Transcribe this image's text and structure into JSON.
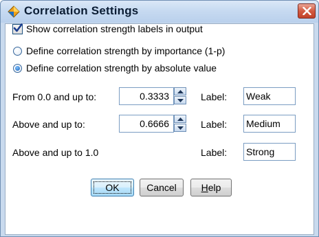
{
  "window": {
    "title": "Correlation Settings",
    "icon": "diamond-app-icon",
    "close_icon": "close-x-icon"
  },
  "options": {
    "show_labels": {
      "label": "Show correlation strength labels in output",
      "checked": true
    },
    "radios": [
      {
        "label": "Define correlation strength by importance (1-p)",
        "checked": false
      },
      {
        "label": "Define correlation strength by absolute value",
        "checked": true
      }
    ]
  },
  "thresholds": [
    {
      "label": "From 0.0 and up to:",
      "value": "0.3333",
      "label_caption": "Label:",
      "strength": "Weak"
    },
    {
      "label": "Above and up to:",
      "value": "0.6666",
      "label_caption": "Label:",
      "strength": "Medium"
    },
    {
      "label": "Above and up to 1.0",
      "label_caption": "Label:",
      "strength": "Strong"
    }
  ],
  "buttons": {
    "ok": "OK",
    "cancel": "Cancel",
    "help_prefix": "H",
    "help_rest": "elp"
  },
  "colors": {
    "title_bar": "#c7daf1",
    "close_button": "#d35a41",
    "default_button": "#bee6fd"
  }
}
